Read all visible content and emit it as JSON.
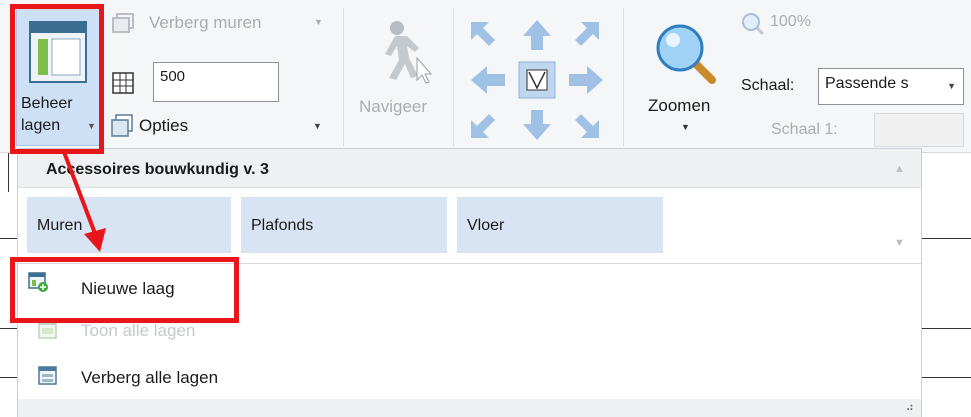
{
  "ribbon": {
    "manage_layers": {
      "line1": "Beheer",
      "line2": "lagen",
      "icon": "layers-panel-icon"
    },
    "hide_walls": {
      "label": "Verberg muren",
      "icon": "cube-icon"
    },
    "grid_size": {
      "value": "500",
      "icon": "grid-icon"
    },
    "options": {
      "label": "Opties",
      "icon": "options-icon"
    },
    "navigate": {
      "label": "Navigeer",
      "icon": "walking-person-icon"
    },
    "zoom": {
      "label": "Zoomen",
      "icon": "magnifier-icon",
      "percent": "100%"
    },
    "scale": {
      "label": "Schaal:",
      "value": "Passende s",
      "scale1_label": "Schaal 1:"
    }
  },
  "menu": {
    "header": "Accessoires bouwkundig v. 3",
    "categories": [
      "Muren",
      "Plafonds",
      "Vloer"
    ],
    "items": [
      {
        "label": "Nieuwe laag",
        "enabled": true,
        "icon": "new-layer-icon"
      },
      {
        "label": "Toon alle lagen",
        "enabled": false,
        "icon": "show-layers-icon"
      },
      {
        "label": "Verberg alle lagen",
        "enabled": true,
        "icon": "hide-layers-icon"
      }
    ]
  },
  "colors": {
    "highlight": "#e8151b",
    "accent_blue": "#4a90d9",
    "tab_fill": "#d8e4f3"
  }
}
